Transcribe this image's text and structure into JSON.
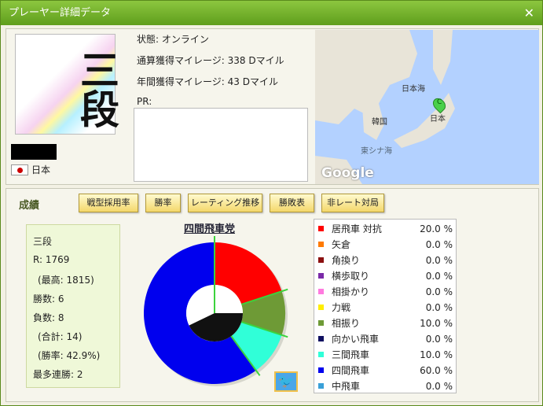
{
  "window": {
    "title": "プレーヤー詳細データ",
    "close_label": "✕"
  },
  "profile": {
    "rank_image_text": "三段",
    "country": "日本",
    "status": "状態: オンライン",
    "total_miles": "通算獲得マイレージ: 338 Dマイル",
    "year_miles": "年間獲得マイレージ: 43 Dマイル",
    "pr_label": "PR:",
    "pr_text": ""
  },
  "map": {
    "label_japan_sea": "日本海",
    "label_korea": "韓国",
    "label_japan": "日本",
    "label_east_china_sea": "東シナ海",
    "marker": "C",
    "brand": "Google"
  },
  "section_title": "成績",
  "tabs": [
    "戦型採用率",
    "勝率",
    "レーティング推移",
    "勝敗表",
    "非レート対局"
  ],
  "stats": {
    "rank": "三段",
    "rating": "R: 1769",
    "max_rating": "(最高: 1815)",
    "wins": "勝数: 6",
    "losses": "負数: 8",
    "total": "(合計: 14)",
    "win_rate": "(勝率: 42.9%)",
    "max_streak": "最多連勝: 2"
  },
  "chart_data": {
    "type": "pie",
    "title": "四間飛車党",
    "series": [
      {
        "name": "居飛車 対抗",
        "value": 20.0,
        "label": "20.0 %",
        "color": "#ff0000"
      },
      {
        "name": "矢倉",
        "value": 0.0,
        "label": "0.0 %",
        "color": "#ff7a00"
      },
      {
        "name": "角換り",
        "value": 0.0,
        "label": "0.0 %",
        "color": "#8b1010"
      },
      {
        "name": "横歩取り",
        "value": 0.0,
        "label": "0.0 %",
        "color": "#7a2aa8"
      },
      {
        "name": "相掛かり",
        "value": 0.0,
        "label": "0.0 %",
        "color": "#ff7adf"
      },
      {
        "name": "力戦",
        "value": 0.0,
        "label": "0.0 %",
        "color": "#ffee00"
      },
      {
        "name": "相振り",
        "value": 10.0,
        "label": "10.0 %",
        "color": "#6e9a36"
      },
      {
        "name": "向かい飛車",
        "value": 0.0,
        "label": "0.0 %",
        "color": "#101060"
      },
      {
        "name": "三間飛車",
        "value": 10.0,
        "label": "10.0 %",
        "color": "#30ffd8"
      },
      {
        "name": "四間飛車",
        "value": 60.0,
        "label": "60.0 %",
        "color": "#0000ee"
      },
      {
        "name": "中飛車",
        "value": 0.0,
        "label": "0.0 %",
        "color": "#3aa0d8"
      }
    ],
    "inner_wins_fraction": 0.4286
  }
}
